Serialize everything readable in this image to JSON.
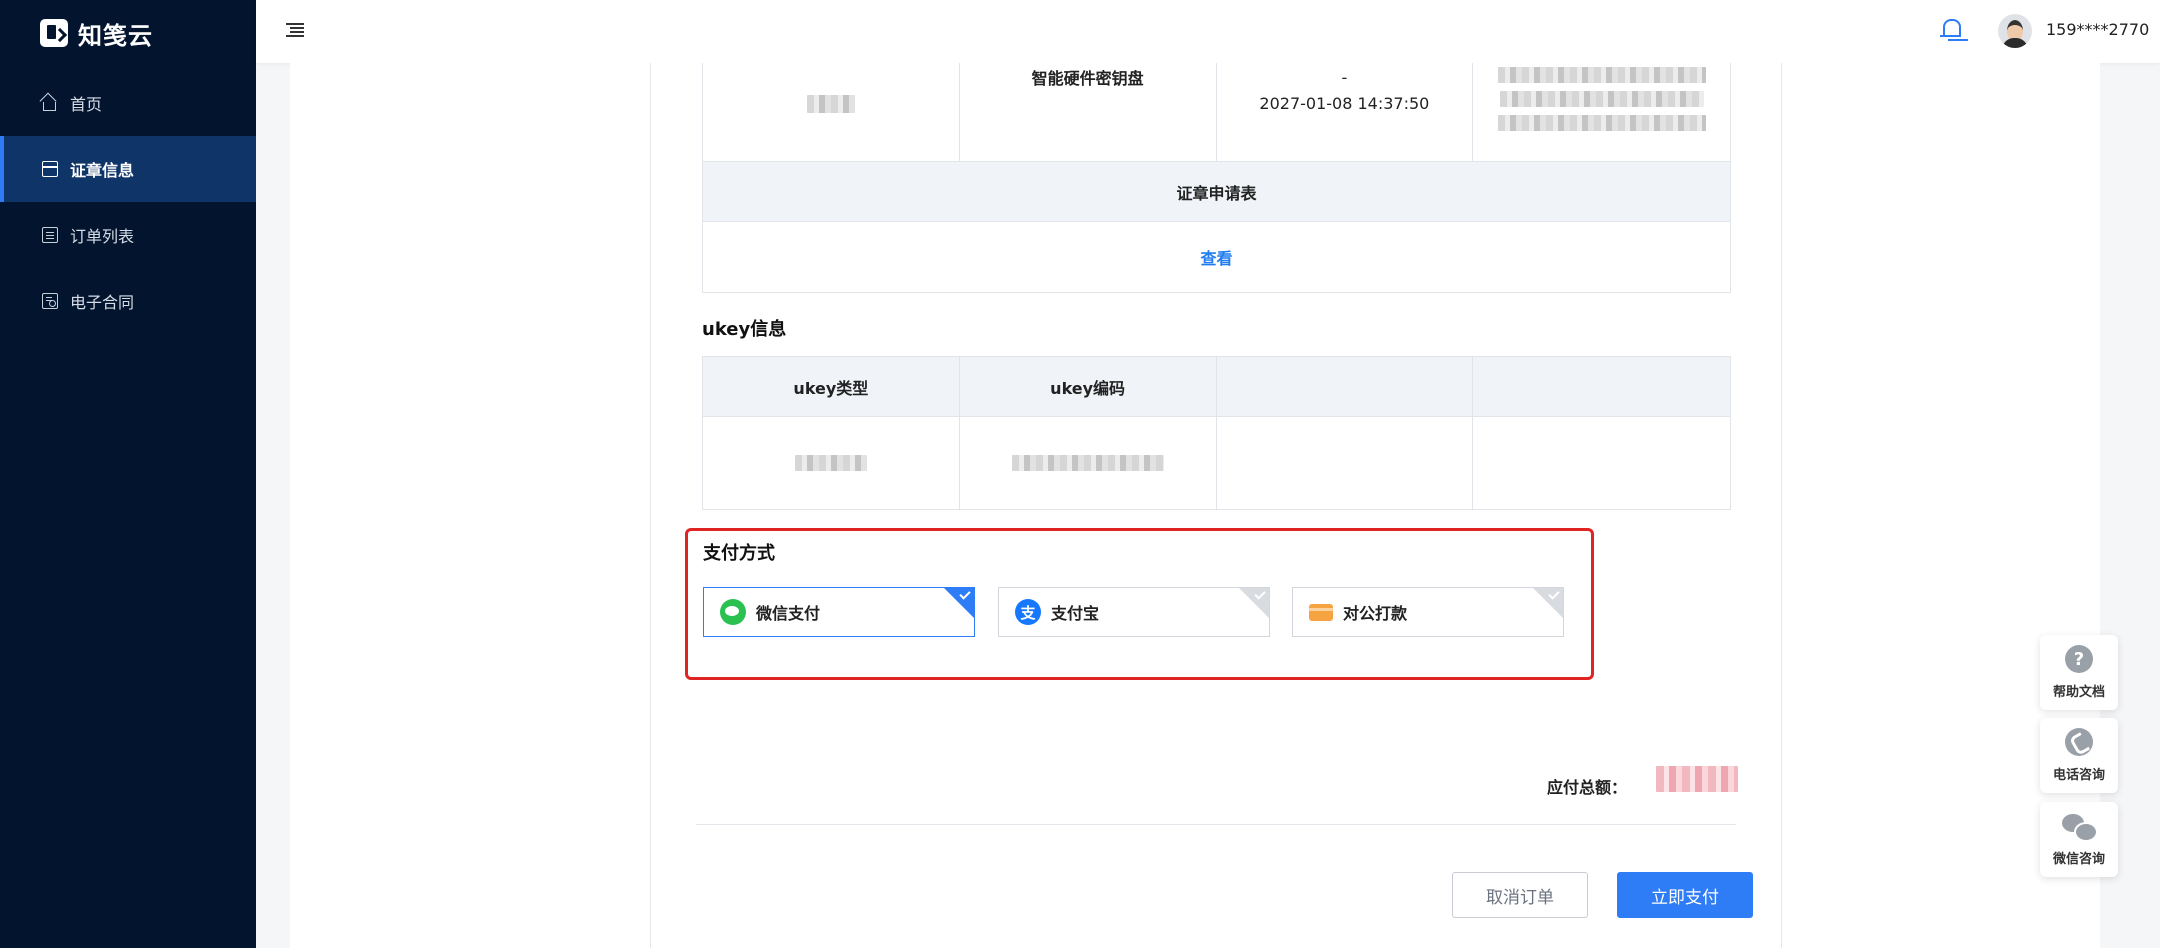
{
  "brand": {
    "name": "知笺云"
  },
  "sidebar": {
    "items": [
      {
        "label": "首页",
        "icon": "home-icon",
        "active": false
      },
      {
        "label": "证章信息",
        "icon": "calendar-icon",
        "active": true
      },
      {
        "label": "订单列表",
        "icon": "list-icon",
        "active": false
      },
      {
        "label": "电子合同",
        "icon": "contract-icon",
        "active": false
      }
    ]
  },
  "header": {
    "username": "159****2770"
  },
  "cert_table": {
    "row": {
      "type": "智能硬件密钥盘",
      "validity_dash": "-",
      "validity_end": "2027-01-08 14:37:50"
    },
    "application_header": "证章申请表",
    "view_link": "查看"
  },
  "ukey": {
    "section_title": "ukey信息",
    "headers": [
      "ukey类型",
      "ukey编码",
      "",
      ""
    ]
  },
  "payment": {
    "section_title": "支付方式",
    "options": [
      {
        "label": "微信支付",
        "icon": "wechat-pay-icon",
        "selected": true
      },
      {
        "label": "支付宝",
        "icon": "alipay-icon",
        "selected": false
      },
      {
        "label": "对公打款",
        "icon": "bank-transfer-icon",
        "selected": false
      }
    ],
    "alipay_glyph": "支"
  },
  "summary": {
    "total_label": "应付总额："
  },
  "actions": {
    "cancel_label": "取消订单",
    "pay_label": "立即支付"
  },
  "float_widgets": [
    {
      "label": "帮助文档",
      "icon": "help-icon",
      "glyph": "?"
    },
    {
      "label": "电话咨询",
      "icon": "phone-icon"
    },
    {
      "label": "微信咨询",
      "icon": "wechat-chat-icon"
    }
  ],
  "colors": {
    "sidebar_bg": "#03152e",
    "accent": "#2e7cf6",
    "highlight_border": "#e02424"
  }
}
